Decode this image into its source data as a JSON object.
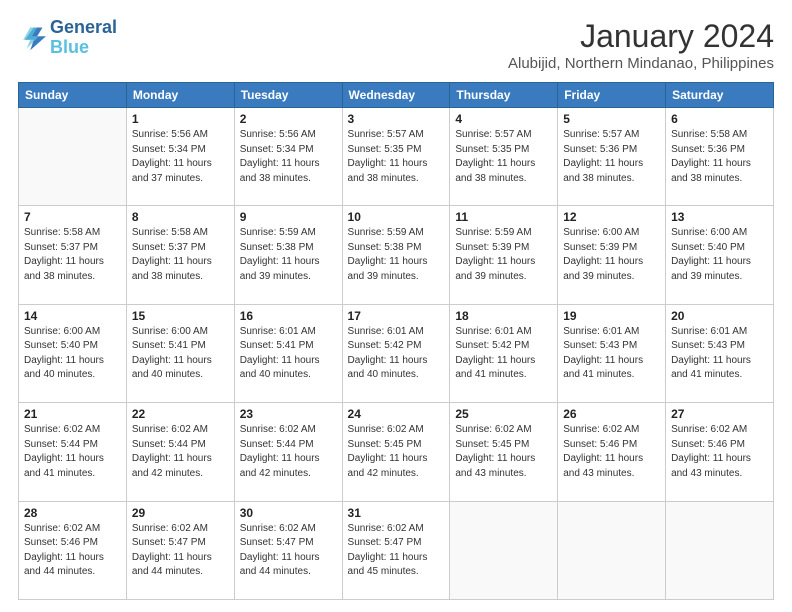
{
  "header": {
    "logo_line1": "General",
    "logo_line2": "Blue",
    "title": "January 2024",
    "subtitle": "Alubijid, Northern Mindanao, Philippines"
  },
  "weekdays": [
    "Sunday",
    "Monday",
    "Tuesday",
    "Wednesday",
    "Thursday",
    "Friday",
    "Saturday"
  ],
  "weeks": [
    [
      {
        "day": "",
        "info": ""
      },
      {
        "day": "1",
        "info": "Sunrise: 5:56 AM\nSunset: 5:34 PM\nDaylight: 11 hours\nand 37 minutes."
      },
      {
        "day": "2",
        "info": "Sunrise: 5:56 AM\nSunset: 5:34 PM\nDaylight: 11 hours\nand 38 minutes."
      },
      {
        "day": "3",
        "info": "Sunrise: 5:57 AM\nSunset: 5:35 PM\nDaylight: 11 hours\nand 38 minutes."
      },
      {
        "day": "4",
        "info": "Sunrise: 5:57 AM\nSunset: 5:35 PM\nDaylight: 11 hours\nand 38 minutes."
      },
      {
        "day": "5",
        "info": "Sunrise: 5:57 AM\nSunset: 5:36 PM\nDaylight: 11 hours\nand 38 minutes."
      },
      {
        "day": "6",
        "info": "Sunrise: 5:58 AM\nSunset: 5:36 PM\nDaylight: 11 hours\nand 38 minutes."
      }
    ],
    [
      {
        "day": "7",
        "info": "Sunrise: 5:58 AM\nSunset: 5:37 PM\nDaylight: 11 hours\nand 38 minutes."
      },
      {
        "day": "8",
        "info": "Sunrise: 5:58 AM\nSunset: 5:37 PM\nDaylight: 11 hours\nand 38 minutes."
      },
      {
        "day": "9",
        "info": "Sunrise: 5:59 AM\nSunset: 5:38 PM\nDaylight: 11 hours\nand 39 minutes."
      },
      {
        "day": "10",
        "info": "Sunrise: 5:59 AM\nSunset: 5:38 PM\nDaylight: 11 hours\nand 39 minutes."
      },
      {
        "day": "11",
        "info": "Sunrise: 5:59 AM\nSunset: 5:39 PM\nDaylight: 11 hours\nand 39 minutes."
      },
      {
        "day": "12",
        "info": "Sunrise: 6:00 AM\nSunset: 5:39 PM\nDaylight: 11 hours\nand 39 minutes."
      },
      {
        "day": "13",
        "info": "Sunrise: 6:00 AM\nSunset: 5:40 PM\nDaylight: 11 hours\nand 39 minutes."
      }
    ],
    [
      {
        "day": "14",
        "info": "Sunrise: 6:00 AM\nSunset: 5:40 PM\nDaylight: 11 hours\nand 40 minutes."
      },
      {
        "day": "15",
        "info": "Sunrise: 6:00 AM\nSunset: 5:41 PM\nDaylight: 11 hours\nand 40 minutes."
      },
      {
        "day": "16",
        "info": "Sunrise: 6:01 AM\nSunset: 5:41 PM\nDaylight: 11 hours\nand 40 minutes."
      },
      {
        "day": "17",
        "info": "Sunrise: 6:01 AM\nSunset: 5:42 PM\nDaylight: 11 hours\nand 40 minutes."
      },
      {
        "day": "18",
        "info": "Sunrise: 6:01 AM\nSunset: 5:42 PM\nDaylight: 11 hours\nand 41 minutes."
      },
      {
        "day": "19",
        "info": "Sunrise: 6:01 AM\nSunset: 5:43 PM\nDaylight: 11 hours\nand 41 minutes."
      },
      {
        "day": "20",
        "info": "Sunrise: 6:01 AM\nSunset: 5:43 PM\nDaylight: 11 hours\nand 41 minutes."
      }
    ],
    [
      {
        "day": "21",
        "info": "Sunrise: 6:02 AM\nSunset: 5:44 PM\nDaylight: 11 hours\nand 41 minutes."
      },
      {
        "day": "22",
        "info": "Sunrise: 6:02 AM\nSunset: 5:44 PM\nDaylight: 11 hours\nand 42 minutes."
      },
      {
        "day": "23",
        "info": "Sunrise: 6:02 AM\nSunset: 5:44 PM\nDaylight: 11 hours\nand 42 minutes."
      },
      {
        "day": "24",
        "info": "Sunrise: 6:02 AM\nSunset: 5:45 PM\nDaylight: 11 hours\nand 42 minutes."
      },
      {
        "day": "25",
        "info": "Sunrise: 6:02 AM\nSunset: 5:45 PM\nDaylight: 11 hours\nand 43 minutes."
      },
      {
        "day": "26",
        "info": "Sunrise: 6:02 AM\nSunset: 5:46 PM\nDaylight: 11 hours\nand 43 minutes."
      },
      {
        "day": "27",
        "info": "Sunrise: 6:02 AM\nSunset: 5:46 PM\nDaylight: 11 hours\nand 43 minutes."
      }
    ],
    [
      {
        "day": "28",
        "info": "Sunrise: 6:02 AM\nSunset: 5:46 PM\nDaylight: 11 hours\nand 44 minutes."
      },
      {
        "day": "29",
        "info": "Sunrise: 6:02 AM\nSunset: 5:47 PM\nDaylight: 11 hours\nand 44 minutes."
      },
      {
        "day": "30",
        "info": "Sunrise: 6:02 AM\nSunset: 5:47 PM\nDaylight: 11 hours\nand 44 minutes."
      },
      {
        "day": "31",
        "info": "Sunrise: 6:02 AM\nSunset: 5:47 PM\nDaylight: 11 hours\nand 45 minutes."
      },
      {
        "day": "",
        "info": ""
      },
      {
        "day": "",
        "info": ""
      },
      {
        "day": "",
        "info": ""
      }
    ]
  ]
}
